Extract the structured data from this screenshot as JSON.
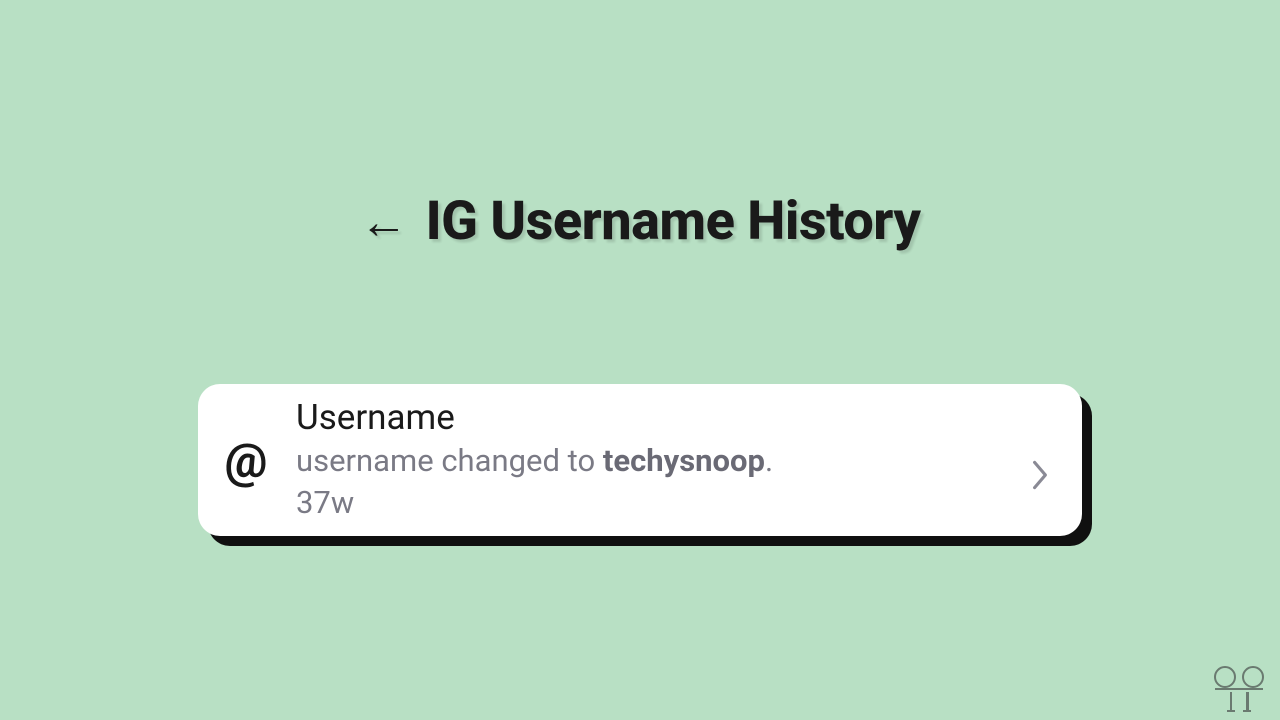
{
  "header": {
    "back_arrow": "←",
    "title": "IG Username History"
  },
  "card": {
    "icon": "@",
    "title": "Username",
    "desc_prefix": "username changed to ",
    "username": "techysnoop",
    "desc_suffix": ".",
    "time": "37w"
  }
}
